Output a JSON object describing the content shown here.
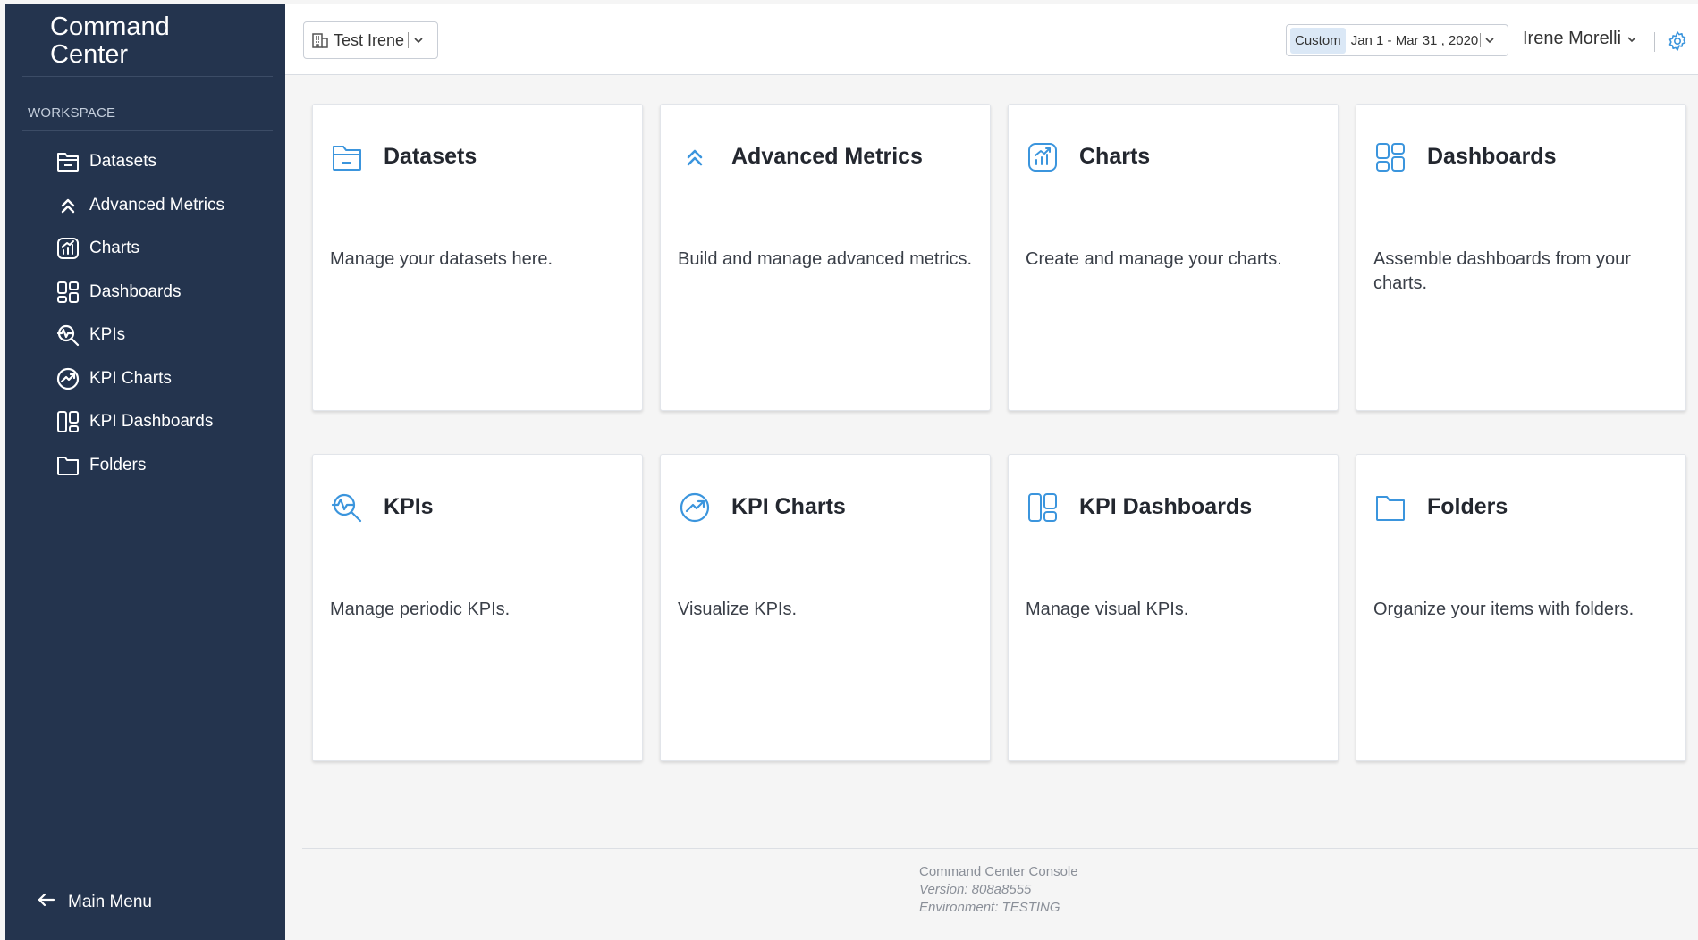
{
  "app": {
    "title": "Command Center"
  },
  "sidebar": {
    "section_label": "WORKSPACE",
    "items": [
      {
        "label": "Datasets",
        "icon": "folder-open-icon"
      },
      {
        "label": "Advanced Metrics",
        "icon": "chevrons-up-icon"
      },
      {
        "label": "Charts",
        "icon": "chart-icon"
      },
      {
        "label": "Dashboards",
        "icon": "dashboard-grid-icon"
      },
      {
        "label": "KPIs",
        "icon": "kpi-search-icon"
      },
      {
        "label": "KPI Charts",
        "icon": "kpi-chart-icon"
      },
      {
        "label": "KPI Dashboards",
        "icon": "kpi-dashboard-icon"
      },
      {
        "label": "Folders",
        "icon": "folder-icon"
      }
    ],
    "main_menu_label": "Main Menu"
  },
  "topbar": {
    "company": "Test Irene",
    "date_preset": "Custom",
    "date_range": "Jan 1 - Mar 31 , 2020",
    "user": "Irene Morelli"
  },
  "cards": [
    {
      "title": "Datasets",
      "desc": "Manage your datasets here."
    },
    {
      "title": "Advanced Metrics",
      "desc": "Build and manage advanced metrics."
    },
    {
      "title": "Charts",
      "desc": "Create and manage your charts."
    },
    {
      "title": "Dashboards",
      "desc": "Assemble dashboards from your charts."
    },
    {
      "title": "KPIs",
      "desc": "Manage periodic KPIs."
    },
    {
      "title": "KPI Charts",
      "desc": "Visualize KPIs."
    },
    {
      "title": "KPI Dashboards",
      "desc": "Manage visual KPIs."
    },
    {
      "title": "Folders",
      "desc": "Organize your items with folders."
    }
  ],
  "footer": {
    "console": "Command Center Console",
    "version": "Version: 808a8555",
    "environment": "Environment: TESTING"
  },
  "colors": {
    "sidebar_bg": "#24344e",
    "accent": "#3b95dd",
    "page_bg": "#f5f5f5"
  }
}
